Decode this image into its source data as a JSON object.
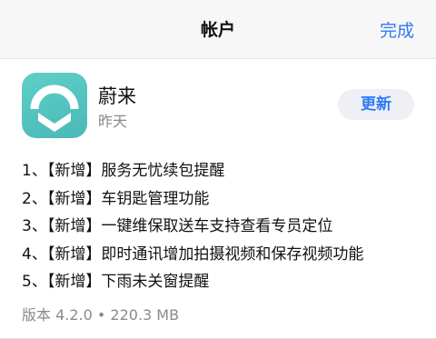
{
  "navbar": {
    "title": "帐户",
    "done_label": "完成"
  },
  "app": {
    "name": "蔚来",
    "date": "昨天",
    "icon": "nio-logo-icon",
    "icon_color": "#4ab9b6",
    "update_label": "更新"
  },
  "release_notes": [
    "1、【新增】服务无忧续包提醒",
    "2、【新增】车钥匙管理功能",
    "3、【新增】一键维保取送车支持查看专员定位",
    "4、【新增】即时通讯增加拍摄视频和保存视频功能",
    "5、【新增】下雨未关窗提醒"
  ],
  "version_info": "版本 4.2.0 • 220.3 MB",
  "colors": {
    "accent": "#2f7bf5",
    "secondary_text": "#8a8a8e",
    "button_bg": "#eef0f5"
  }
}
